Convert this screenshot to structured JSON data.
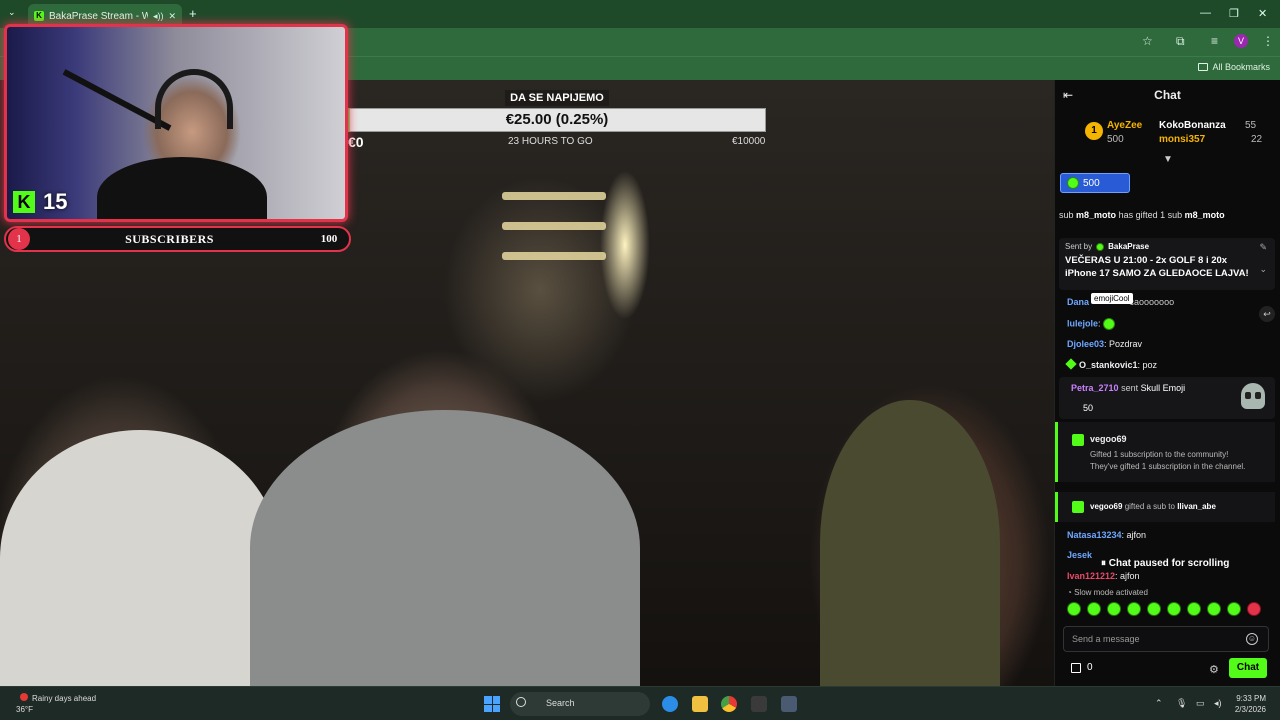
{
  "browser": {
    "tab_title": "BakaPrase Stream - Watch",
    "new_tab_glyph": "+",
    "bookmarks_label": "All Bookmarks",
    "profile_initial": "V"
  },
  "goal": {
    "title": "DA SE NAPIJEMO",
    "amount_label": "€25.00 (0.25%)",
    "progress_fraction": 0.0025,
    "start_label": "€0",
    "remaining_label": "23 HOURS TO GO",
    "target_label": "€10000"
  },
  "webcam": {
    "kick_letter": "K",
    "viewer_count": "15"
  },
  "sub_goal": {
    "current": "1",
    "label": "SUBSCRIBERS",
    "target": "100",
    "accent": "#e2334a"
  },
  "chat": {
    "title": "Chat",
    "leaderboard": {
      "rank": "1",
      "first_name": "AyeZee",
      "first_value": "500",
      "second_name": "KokoBonanza",
      "second_value": "55",
      "third_name": "monsi357",
      "third_value": "22"
    },
    "kicks_value": "500",
    "sub_line_prefix": "sub",
    "sub_line_user": "m8_moto",
    "sub_line_text": "has gifted 1 sub",
    "sub_line_user2": "m8_moto",
    "pinned": {
      "sent_by": "Sent by",
      "author": "BakaPrase",
      "text": "VEČERAS U 21:00 - 2x GOLF 8 i 20x iPhone 17 SAMO ZA GLEDAOCE LAJVA!"
    },
    "tooltip": "emojiCool",
    "messages": [
      {
        "user": "Dana",
        "text": "caooooooo",
        "color": "#6fa8ff"
      },
      {
        "user": "lulejole",
        "text": ":",
        "color": "#6fa8ff"
      },
      {
        "user": "Djolee03",
        "text": ": Pozdrav",
        "color": "#6fa8ff"
      },
      {
        "user": "O_stankovic1",
        "text": ": poz",
        "color": "#ffffff"
      }
    ],
    "kick_gift": {
      "user": "Petra_2710",
      "text": "sent",
      "item": "Skull Emoji",
      "amount": "50"
    },
    "sub_card": {
      "user": "vegoo69",
      "line1": "Gifted 1 subscription to the community!",
      "line2": "They've gifted 1 subscription in the channel."
    },
    "gift_card": {
      "user": "vegoo69",
      "text": "gifted a sub to",
      "recipient": "Ilivan_abe"
    },
    "late_messages": [
      {
        "user": "Natasa13234",
        "text": ": ajfon",
        "color": "#6fa8ff"
      },
      {
        "user": "Jesek",
        "text": "",
        "color": "#6fa8ff"
      },
      {
        "user": "Ivan121212",
        "text": ": ajfon",
        "color": "#e84a6a"
      }
    ],
    "paused_label": "Chat paused for scrolling",
    "slow_mode": "Slow mode activated",
    "input_placeholder": "Send a message",
    "points": "0",
    "send_label": "Chat"
  },
  "taskbar": {
    "weather_line1": "Rainy days ahead",
    "weather_line2": "36°F",
    "search_label": "Search",
    "time": "9:33 PM",
    "date": "2/3/2026"
  },
  "colors": {
    "kick_green": "#53fc18",
    "gold": "#f5b400",
    "chat_bg": "#0b0b0c"
  },
  "icons": [
    "menu-icon",
    "audio-icon",
    "close-icon",
    "star-icon",
    "extensions-icon",
    "folder-icon",
    "collapse-icon",
    "edit-icon",
    "chevron-down-icon",
    "reply-icon",
    "gift-icon",
    "settings-icon",
    "emoji-icon",
    "windows-icon",
    "search-icon"
  ]
}
